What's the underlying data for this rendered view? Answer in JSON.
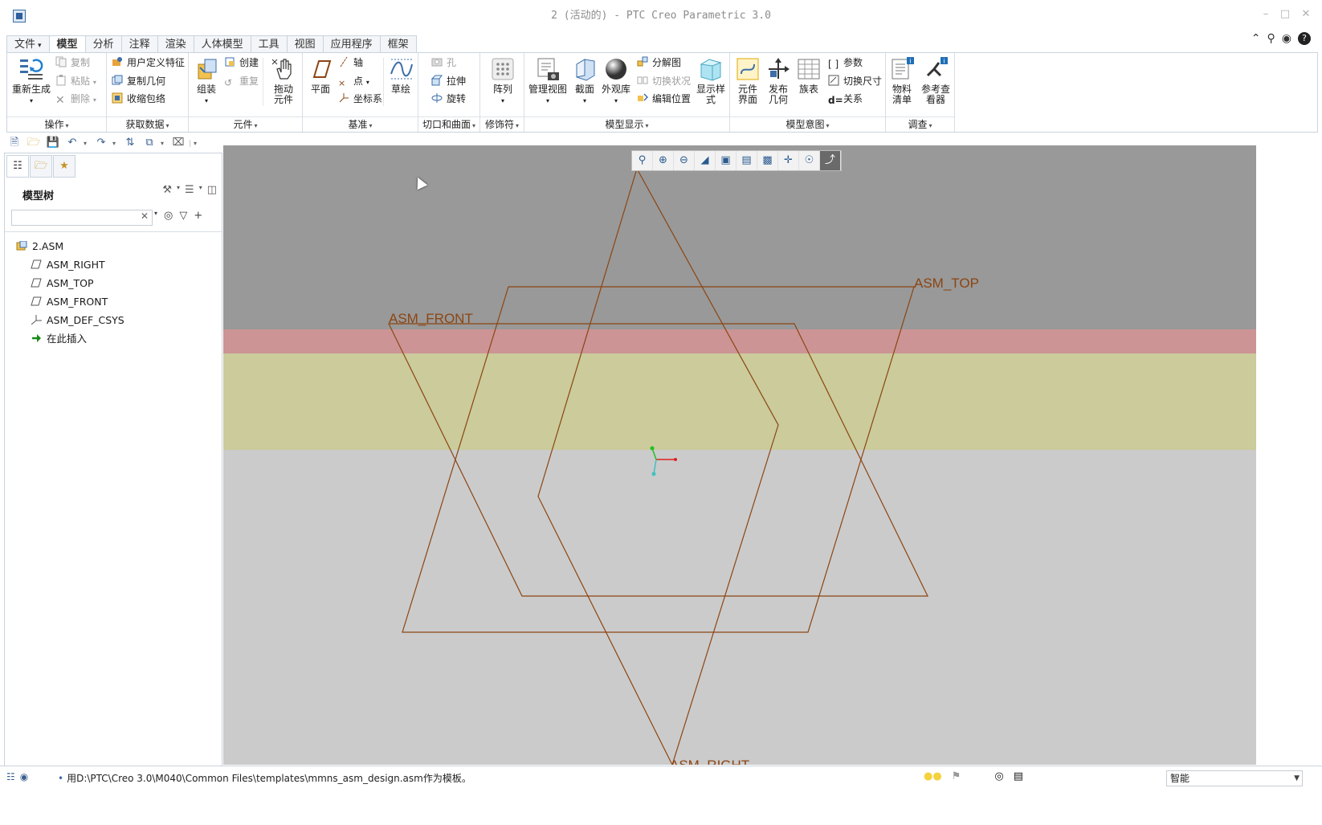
{
  "window": {
    "title": "2 (活动的) - PTC Creo Parametric 3.0"
  },
  "ribbon_tabs": [
    {
      "label": "文件",
      "dropdown": true
    },
    {
      "label": "模型",
      "active": true
    },
    {
      "label": "分析"
    },
    {
      "label": "注释"
    },
    {
      "label": "渲染"
    },
    {
      "label": "人体模型"
    },
    {
      "label": "工具"
    },
    {
      "label": "视图"
    },
    {
      "label": "应用程序"
    },
    {
      "label": "框架"
    }
  ],
  "ribbon": {
    "operations": {
      "label": "操作",
      "regenerate": "重新生成",
      "copy": "复制",
      "paste": "粘贴",
      "delete": "删除"
    },
    "get_data": {
      "label": "获取数据",
      "udf": "用户定义特征",
      "copy_geom": "复制几何",
      "shrinkwrap": "收缩包络"
    },
    "component": {
      "label": "元件",
      "assemble": "组装",
      "create": "创建",
      "repeat": "重复",
      "drag": "拖动\n元件"
    },
    "datum": {
      "label": "基准",
      "plane": "平面",
      "axis": "轴",
      "point": "点",
      "csys": "坐标系",
      "sketch": "草绘"
    },
    "cuts": {
      "label": "切口和曲面",
      "hole": "孔",
      "extrude": "拉伸",
      "revolve": "旋转"
    },
    "modifiers": {
      "label": "修饰符",
      "pattern": "阵列"
    },
    "model_display": {
      "label": "模型显示",
      "manage_views": "管理视图",
      "section": "截面",
      "appearance": "外观库",
      "exploded": "分解图",
      "toggle_status": "切换状况",
      "edit_position": "编辑位置",
      "display_style": "显示样\n式"
    },
    "model_intent": {
      "label": "模型意图",
      "comp_interface": "元件\n界面",
      "publish_geom": "发布\n几何",
      "family_table": "族表",
      "params": "参数",
      "switch_dims": "切换尺寸",
      "relations": "关系"
    },
    "investigate": {
      "label": "调查",
      "bom": "物料\n清单",
      "ref_viewer": "参考查\n看器"
    }
  },
  "model_tree": {
    "header": "模型树",
    "search_value": "",
    "root": "2.ASM",
    "children": [
      {
        "label": "ASM_RIGHT",
        "icon": "datum-plane-icon"
      },
      {
        "label": "ASM_TOP",
        "icon": "datum-plane-icon"
      },
      {
        "label": "ASM_FRONT",
        "icon": "datum-plane-icon"
      },
      {
        "label": "ASM_DEF_CSYS",
        "icon": "csys-icon"
      },
      {
        "label": "在此插入",
        "icon": "insert-here-icon"
      }
    ]
  },
  "viewport": {
    "datum_labels": {
      "top": "ASM_TOP",
      "front": "ASM_FRONT",
      "right": "ASM_RIGHT"
    },
    "colors": {
      "background": "#cbcbcb",
      "top_band": "#999999",
      "red_band": "#cc9494",
      "yellow_band": "#cbcb9b",
      "datum_line": "#8b4513",
      "csys_x": "#e02020",
      "csys_y": "#20c020",
      "csys_z": "#40c0c0"
    }
  },
  "statusbar": {
    "message": "用D:\\PTC\\Creo 3.0\\M040\\Common Files\\templates\\mmns_asm_design.asm作为模板。",
    "filter": "智能"
  }
}
